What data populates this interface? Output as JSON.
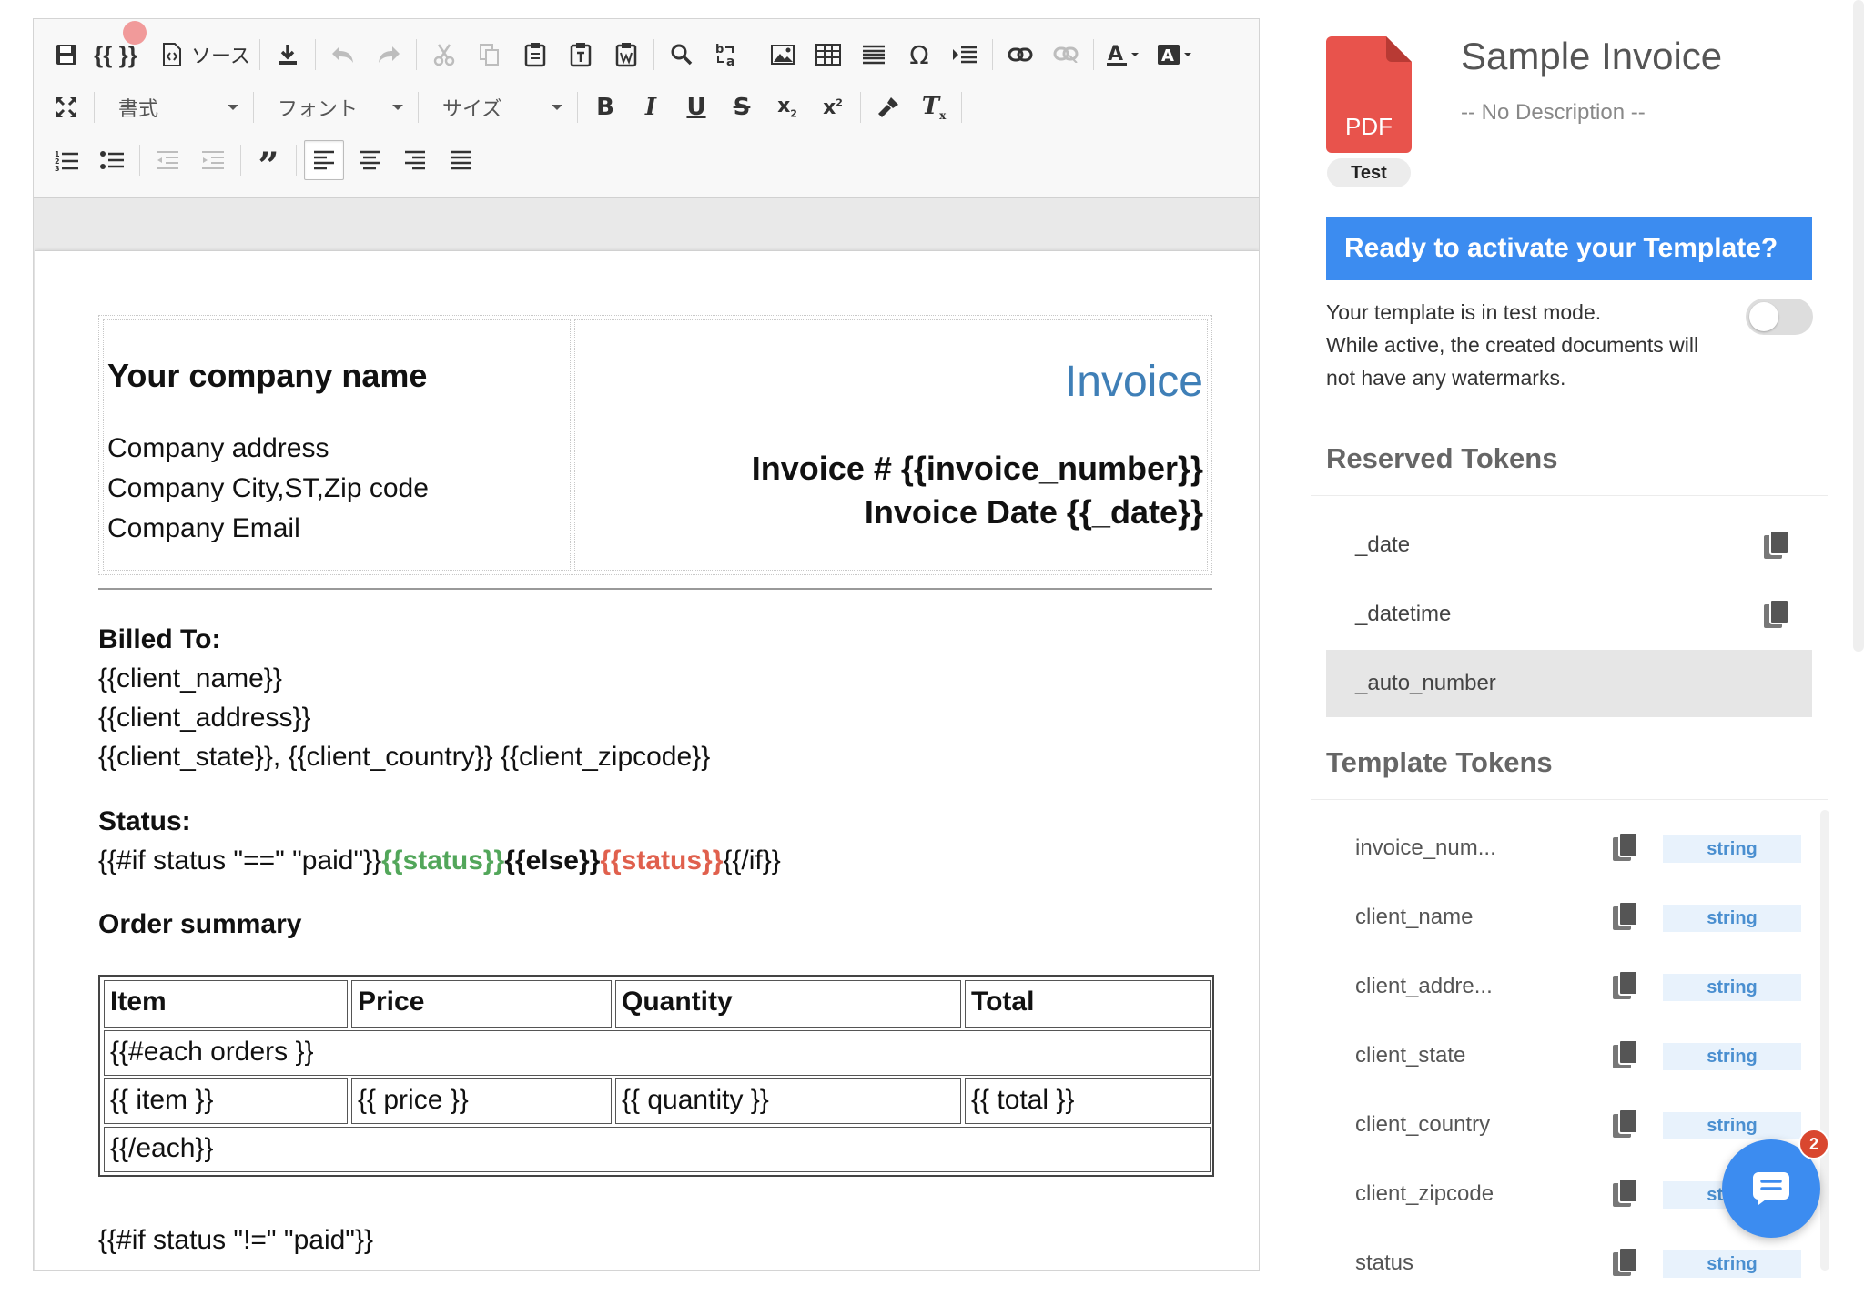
{
  "toolbar": {
    "source_label": "ソース",
    "format_label": "書式",
    "font_label": "フォント",
    "size_label": "サイズ",
    "braces_label": "{{ }}"
  },
  "document": {
    "company_name": "Your company name",
    "company_address": "Company address",
    "company_city": "Company City,ST,Zip code",
    "company_email": "Company Email",
    "invoice_title": "Invoice",
    "invoice_number": "Invoice # {{invoice_number}}",
    "invoice_date": "Invoice Date {{_date}}",
    "billed_to_heading": "Billed To:",
    "billed_lines": [
      "{{client_name}}",
      "{{client_address}}",
      "{{client_state}}, {{client_country}} {{client_zipcode}}"
    ],
    "status_heading": "Status:",
    "status_if": "{{#if status \"==\" \"paid\"}}",
    "status_var_1": "{{status}}",
    "status_else": "{{else}}",
    "status_var_2": "{{status}}",
    "status_endif": "{{/if}}",
    "order_summary_heading": "Order summary",
    "table_headers": [
      "Item",
      "Price",
      "Quantity",
      "Total"
    ],
    "each_open": "{{#each orders }}",
    "row_values": [
      "{{ item }}",
      "{{ price }}",
      "{{ quantity }}",
      "{{ total }}"
    ],
    "each_close": "{{/each}}",
    "footer_if": "{{#if status \"!=\" \"paid\"}}"
  },
  "sidebar": {
    "file_type": "PDF",
    "mode_badge": "Test",
    "template_title": "Sample Invoice",
    "template_description": "-- No Description --",
    "cta": "Ready to activate your Template?",
    "mode_lines": [
      "Your template is in test mode.",
      "While active, the created documents will",
      "not have any watermarks."
    ],
    "toggle_on": false,
    "reserved_heading": "Reserved Tokens",
    "reserved_tokens": [
      "_date",
      "_datetime",
      "_auto_number"
    ],
    "template_heading": "Template Tokens",
    "template_tokens": [
      {
        "name": "invoice_num...",
        "type": "string"
      },
      {
        "name": "client_name",
        "type": "string"
      },
      {
        "name": "client_addre...",
        "type": "string"
      },
      {
        "name": "client_state",
        "type": "string"
      },
      {
        "name": "client_country",
        "type": "string"
      },
      {
        "name": "client_zipcode",
        "type": "string"
      },
      {
        "name": "status",
        "type": "string"
      }
    ],
    "chat_badge_count": "2"
  },
  "colors": {
    "accent": "#3c8cf0",
    "pdf_red": "#e8534c",
    "invoice_blue": "#3f7fb7",
    "status_green": "#52a65a",
    "status_red": "#e0604d"
  }
}
